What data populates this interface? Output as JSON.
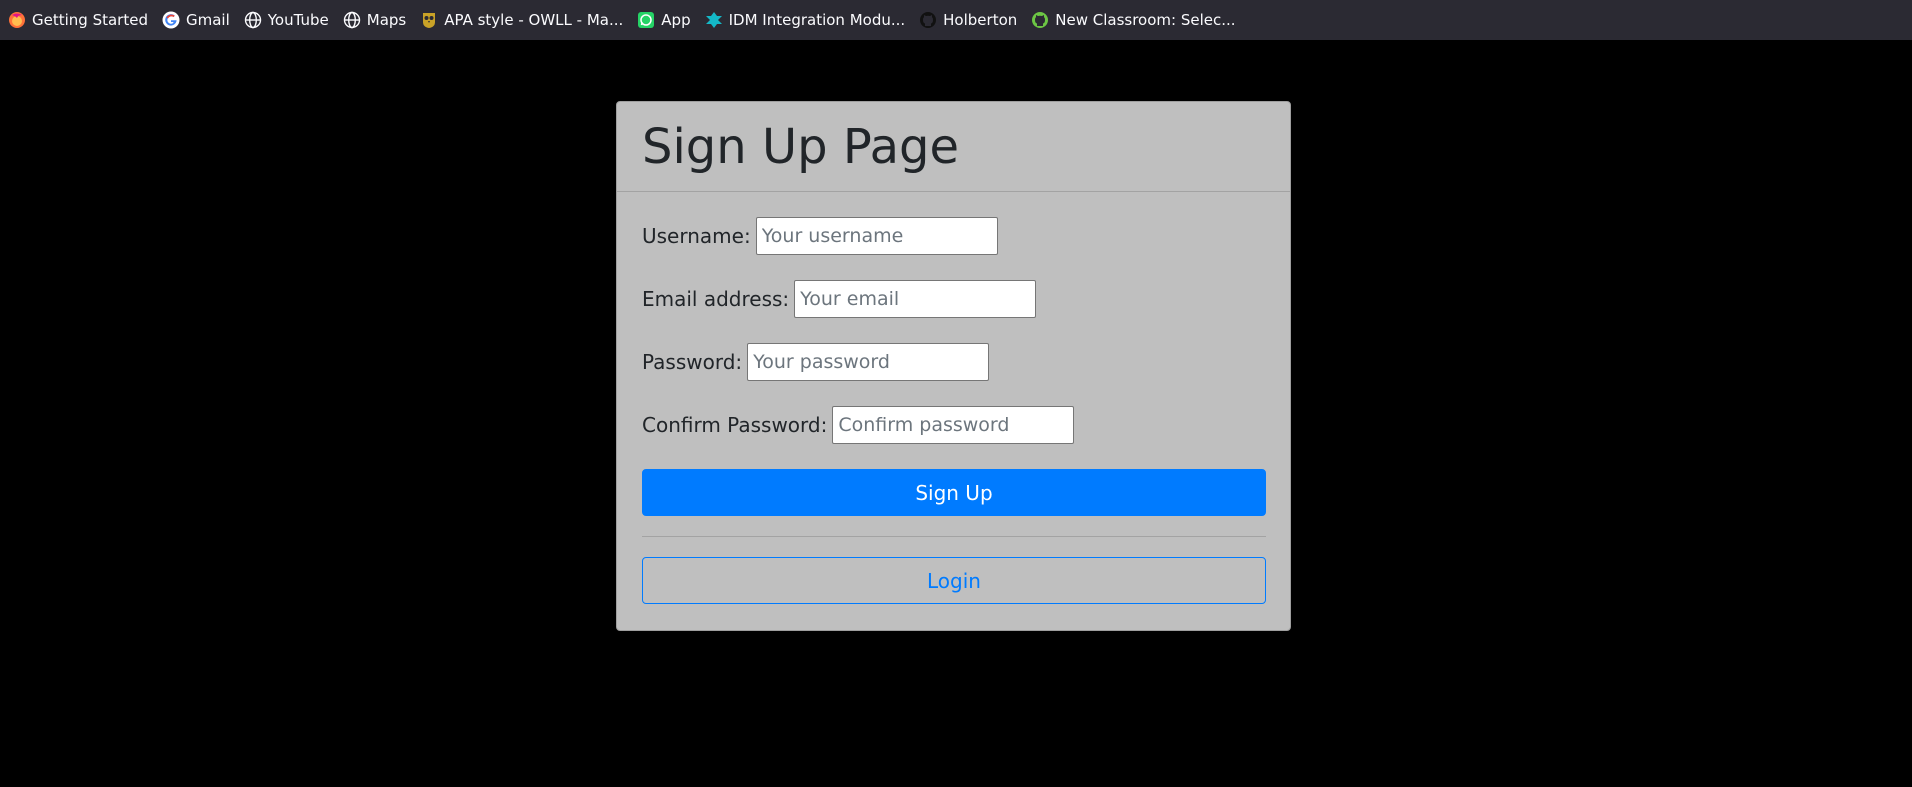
{
  "bookmarks": [
    {
      "label": "Getting Started",
      "icon": "firefox-icon"
    },
    {
      "label": "Gmail",
      "icon": "google-icon"
    },
    {
      "label": "YouTube",
      "icon": "globe-icon"
    },
    {
      "label": "Maps",
      "icon": "globe-icon"
    },
    {
      "label": "APA style - OWLL - Ma...",
      "icon": "owl-icon"
    },
    {
      "label": "App",
      "icon": "whatsapp-icon"
    },
    {
      "label": "IDM Integration Modu...",
      "icon": "idm-icon"
    },
    {
      "label": "Holberton",
      "icon": "github-icon"
    },
    {
      "label": "New Classroom: Selec...",
      "icon": "github-icon"
    }
  ],
  "colors": {
    "page_background": "#000000",
    "bookmarks_bar": "#2b2a33",
    "card_background": "#bfbfbf",
    "primary": "#007bff"
  },
  "card": {
    "title": "Sign Up Page",
    "fields": {
      "username": {
        "label": "Username:",
        "placeholder": "Your username",
        "value": ""
      },
      "email": {
        "label": "Email address:",
        "placeholder": "Your email",
        "value": ""
      },
      "password": {
        "label": "Password:",
        "placeholder": "Your password",
        "value": ""
      },
      "confirm_password": {
        "label": "Confirm Password:",
        "placeholder": "Confirm password",
        "value": ""
      }
    },
    "signup_button": "Sign Up",
    "login_button": "Login"
  }
}
